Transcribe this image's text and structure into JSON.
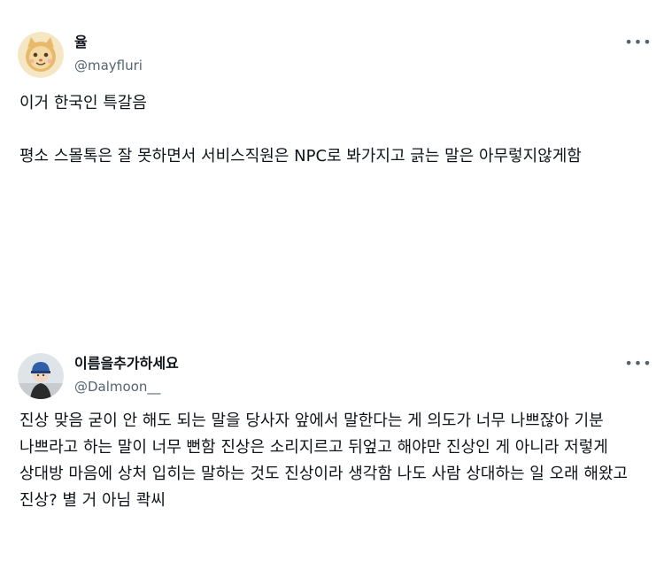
{
  "tweets": [
    {
      "display_name": "율",
      "handle": "@mayfluri",
      "more_icon": "more-horizontal-icon",
      "avatar_icon": "cat-avatar",
      "paragraphs": [
        "이거 한국인 특갈음",
        "평소 스몰톡은 잘 못하면서 서비스직원은 NPC로 봐가지고 긁는 말은 아무렇지않게함"
      ]
    },
    {
      "display_name": "이름을추가하세요",
      "handle": "@Dalmoon__",
      "more_icon": "more-horizontal-icon",
      "avatar_icon": "person-with-helmet-avatar",
      "paragraphs": [
        "진상 맞음 굳이 안 해도 되는 말을 당사자 앞에서 말한다는 게 의도가 너무 나쁘잖아 기분 나쁘라고 하는 말이 너무 뻔함 진상은 소리지르고 뒤엎고 해야만 진상인 게 아니라 저렇게 상대방 마음에 상처 입히는 말하는 것도 진상이라 생각함 나도 사람 상대하는 일 오래 해왔고 진상? 별 거 아님 콱씨"
      ]
    }
  ],
  "colors": {
    "text_primary": "#0f1419",
    "text_secondary": "#536471",
    "background": "#ffffff"
  }
}
